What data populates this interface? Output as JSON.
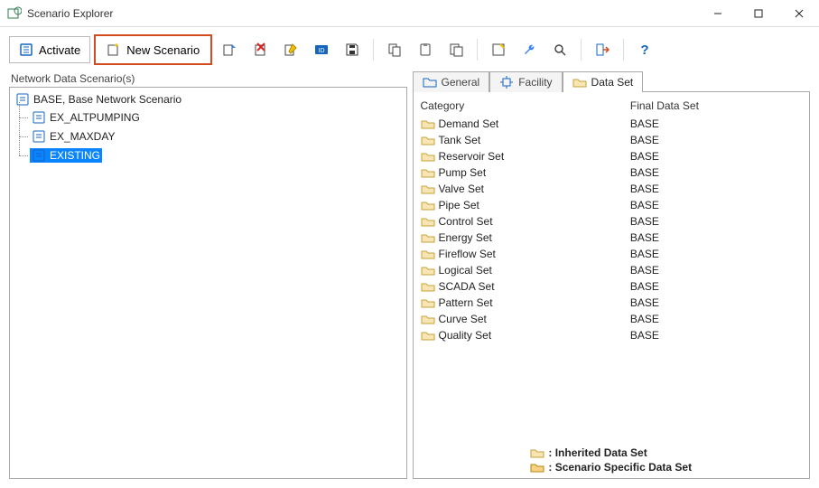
{
  "window": {
    "title": "Scenario Explorer"
  },
  "toolbar": {
    "activate_label": "Activate",
    "new_scenario_label": "New Scenario"
  },
  "left": {
    "header": "Network Data Scenario(s)"
  },
  "tree": {
    "root": {
      "label": "BASE, Base Network Scenario",
      "children": [
        {
          "label": "EX_ALTPUMPING"
        },
        {
          "label": "EX_MAXDAY"
        },
        {
          "label": "EXISTING",
          "selected": true
        }
      ]
    }
  },
  "tabs": {
    "general": "General",
    "facility": "Facility",
    "data_set": "Data Set",
    "active": "data_set"
  },
  "dataset_table": {
    "columns": {
      "category": "Category",
      "final": "Final Data Set"
    },
    "rows": [
      {
        "category": "Demand Set",
        "final": "BASE"
      },
      {
        "category": "Tank Set",
        "final": "BASE"
      },
      {
        "category": "Reservoir Set",
        "final": "BASE"
      },
      {
        "category": "Pump Set",
        "final": "BASE"
      },
      {
        "category": "Valve Set",
        "final": "BASE"
      },
      {
        "category": "Pipe Set",
        "final": "BASE"
      },
      {
        "category": "Control Set",
        "final": "BASE"
      },
      {
        "category": "Energy Set",
        "final": "BASE"
      },
      {
        "category": "Fireflow Set",
        "final": "BASE"
      },
      {
        "category": "Logical Set",
        "final": "BASE"
      },
      {
        "category": "SCADA Set",
        "final": "BASE"
      },
      {
        "category": "Pattern Set",
        "final": "BASE"
      },
      {
        "category": "Curve Set",
        "final": "BASE"
      },
      {
        "category": "Quality Set",
        "final": "BASE"
      }
    ]
  },
  "legend": {
    "inherited": ": Inherited Data Set",
    "specific": ": Scenario Specific Data Set"
  }
}
